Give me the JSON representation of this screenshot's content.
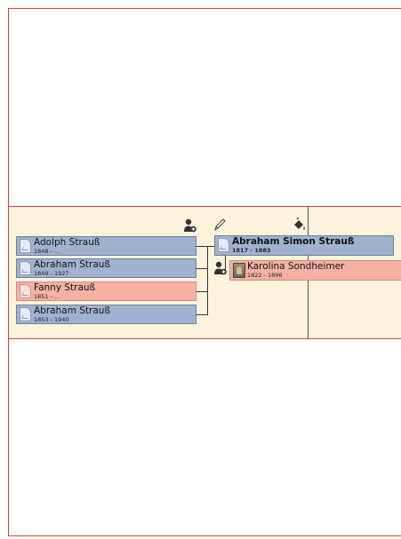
{
  "children": [
    {
      "name": "Adolph Strauß",
      "dates": "1848 - ...",
      "sex": "male"
    },
    {
      "name": "Abraham Strauß",
      "dates": "1849 - 1927",
      "sex": "male"
    },
    {
      "name": "Fanny Strauß",
      "dates": "1851 - ...",
      "sex": "female"
    },
    {
      "name": "Abraham Strauß",
      "dates": "1853 - 1940",
      "sex": "male"
    }
  ],
  "focus": {
    "name": "Abraham Simon Strauß",
    "dates": "1817 - 1883",
    "sex": "male"
  },
  "spouse": {
    "name": "Karolina Sondheimer",
    "dates": "1822 - 1896",
    "sex": "female"
  },
  "icons": {
    "add_child": "add-person-icon",
    "edit": "pencil-icon",
    "paint": "paint-bucket-icon",
    "add_spouse": "add-person-icon"
  },
  "colors": {
    "male_card": "#9fb3d1",
    "female_card": "#f6b0a4",
    "band": "#fdf3dc",
    "frame": "#e03a3a"
  }
}
